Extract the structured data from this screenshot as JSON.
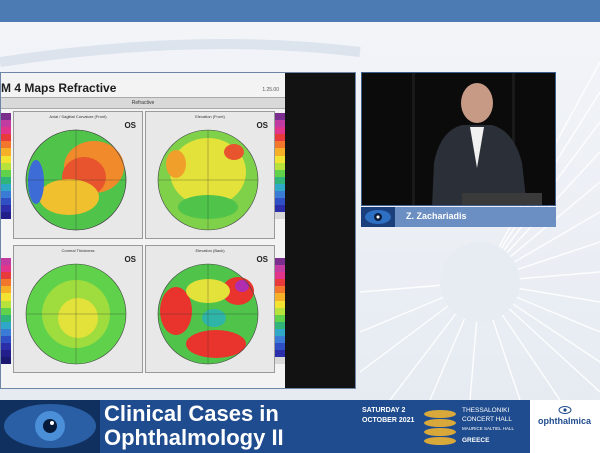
{
  "slide": {
    "title": "M   4 Maps Refractive",
    "date": "1.25.00",
    "section": "Refractive",
    "maps": [
      {
        "label": "Axial / Sagittal Curvature (Front)",
        "eye": "OS"
      },
      {
        "label": "Elevation (Front)",
        "eye": "OS"
      },
      {
        "label": "Corneal Thickness",
        "eye": "OS"
      },
      {
        "label": "Elevation (Back)",
        "eye": "OS"
      }
    ]
  },
  "speaker": {
    "name": "Z. Zachariadis"
  },
  "banner": {
    "title_line1": "Clinical Cases in",
    "title_line2": "Ophthalmology II",
    "date_line1": "SATURDAY 2",
    "date_line2": "OCTOBER 2021",
    "venue_line1": "THESSALONIKI",
    "venue_line2": "CONCERT HALL",
    "venue_line3": "MAURICE SALTIEL HALL",
    "venue_line4": "GREECE",
    "brand": "ophthalmica"
  },
  "colors": {
    "banner_blue": "#1f4c8e",
    "nameplate_blue": "#6b8fc3",
    "topbar_blue": "#4b7bb2"
  }
}
